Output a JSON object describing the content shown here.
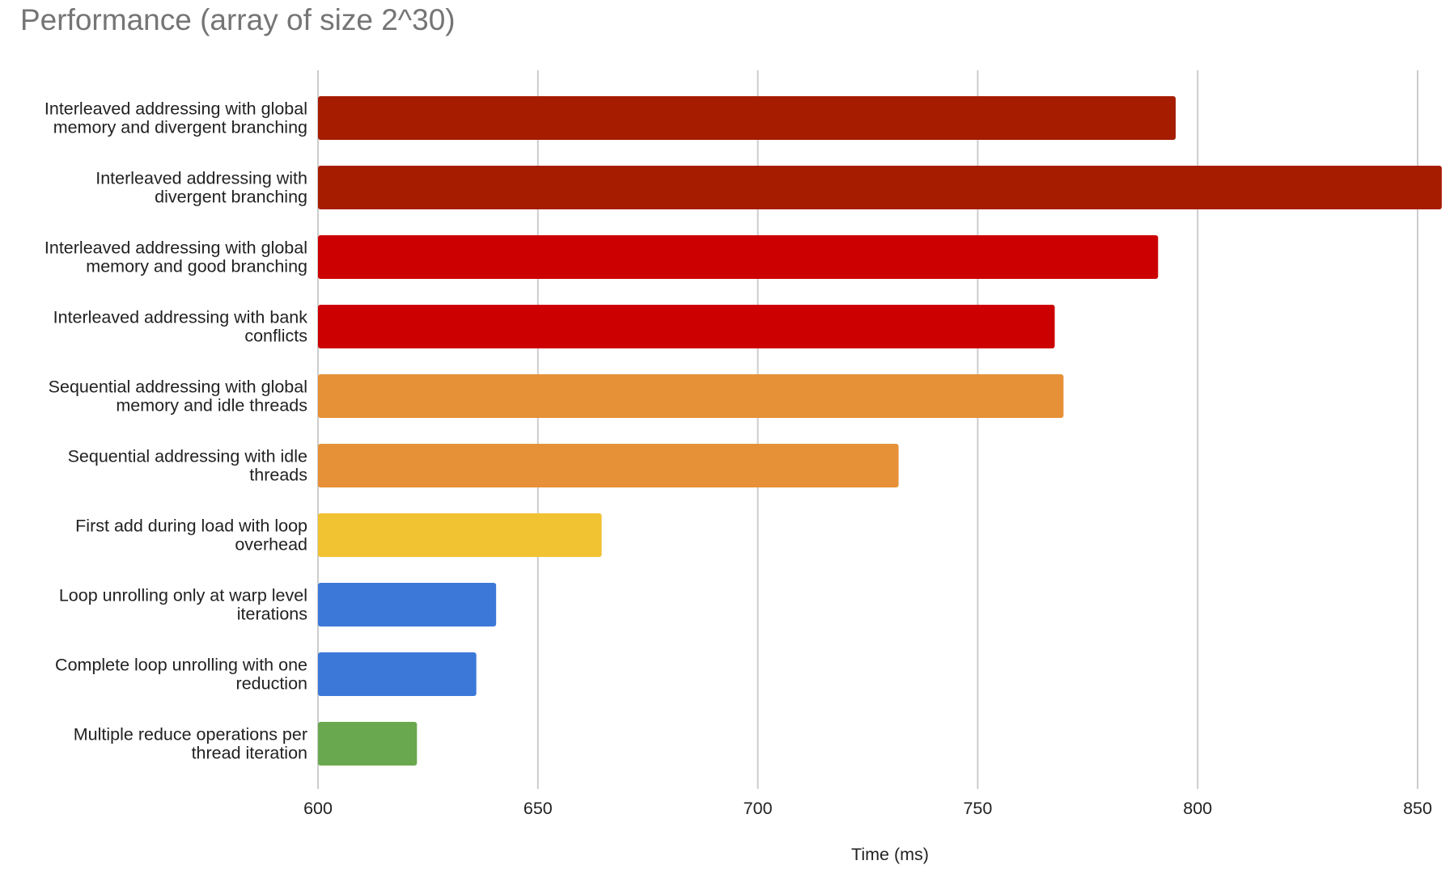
{
  "chart_data": {
    "type": "bar",
    "orientation": "horizontal",
    "title": "Performance (array of size 2^30)",
    "xlabel": "Time (ms)",
    "ylabel": "",
    "xlim": [
      600,
      850
    ],
    "xticks": [
      600,
      650,
      700,
      750,
      800,
      850
    ],
    "grid": true,
    "legend": "none",
    "categories": [
      "Interleaved addressing with global memory and divergent branching",
      "Interleaved addressing with divergent branching",
      "Interleaved addressing with global memory and good branching",
      "Interleaved addressing with bank conflicts",
      "Sequential addressing with global memory and idle threads",
      "Sequential addressing with idle threads",
      "First add during load with loop overhead",
      "Loop unrolling only at warp level iterations",
      "Complete loop unrolling with one reduction",
      "Multiple reduce operations per thread iteration"
    ],
    "category_lines": [
      [
        "Interleaved addressing with global",
        "memory and divergent branching"
      ],
      [
        "Interleaved addressing with",
        "divergent branching"
      ],
      [
        "Interleaved addressing with global",
        "memory and good branching"
      ],
      [
        "Interleaved addressing with bank",
        "conflicts"
      ],
      [
        "Sequential addressing with global",
        "memory and idle threads"
      ],
      [
        "Sequential addressing with idle",
        "threads"
      ],
      [
        "First add during load with loop",
        "overhead"
      ],
      [
        "Loop unrolling only at warp level",
        "iterations"
      ],
      [
        "Complete loop unrolling with one",
        "reduction"
      ],
      [
        "Multiple reduce operations per",
        "thread iteration"
      ]
    ],
    "values": [
      795,
      855.5,
      791,
      767.5,
      769.5,
      732,
      664.5,
      640.5,
      636,
      622.5
    ],
    "colors": [
      "#A61C00",
      "#A61C00",
      "#CC0000",
      "#CC0000",
      "#E69138",
      "#E69138",
      "#F1C232",
      "#3C78D8",
      "#3C78D8",
      "#6AA84F"
    ]
  }
}
